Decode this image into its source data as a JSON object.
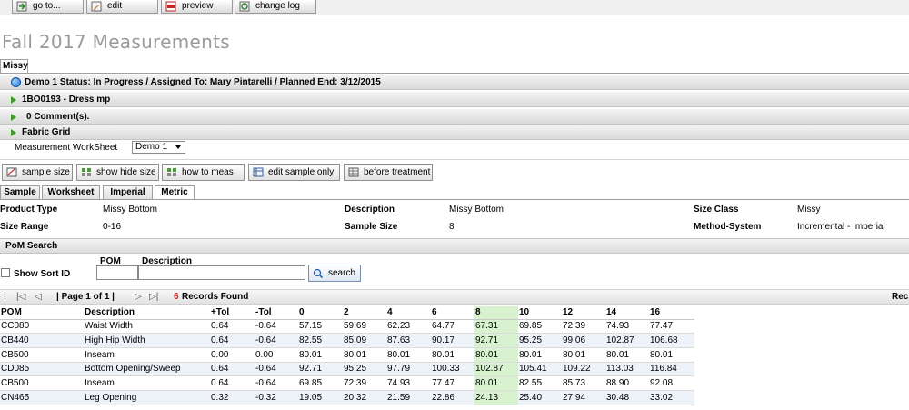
{
  "toolbar": {
    "goto": "go to...",
    "edit": "edit",
    "preview": "preview",
    "change_log": "change log"
  },
  "page_title": "Fall 2017 Measurements",
  "tab": "Missy",
  "sections": {
    "demo": "Demo 1  Status: In Progress / Assigned To: Mary Pintarelli / Planned End: 3/12/2015",
    "style": "1BO0193 - Dress mp",
    "comments": "0 Comment(s).",
    "fabric": "Fabric Grid"
  },
  "worksheet": {
    "label": "Measurement WorkSheet",
    "selected": "Demo 1"
  },
  "actions": {
    "sample_size": "sample size",
    "show_hide_size": "show hide size",
    "how_to_meas": "how to meas",
    "edit_sample_only": "edit sample only",
    "before_treatment": "before treatment"
  },
  "subtabs": [
    "Sample",
    "Worksheet",
    "Imperial",
    "Metric"
  ],
  "info": {
    "product_type_label": "Product Type",
    "product_type": "Missy Bottom",
    "description_label": "Description",
    "description": "Missy Bottom",
    "size_class_label": "Size Class",
    "size_class": "Missy",
    "size_range_label": "Size Range",
    "size_range": "0-16",
    "sample_size_label": "Sample Size",
    "sample_size": "8",
    "method_label": "Method-System",
    "method": "Incremental - Imperial"
  },
  "pom_search": {
    "title": "PoM Search",
    "show_sort": "Show Sort ID",
    "pom_label": "POM",
    "desc_label": "Description",
    "search_btn": "search"
  },
  "pager": {
    "page": "| Page 1 of 1 |",
    "count": "6",
    "found": "Records Found",
    "right": "Rec"
  },
  "grid": {
    "headers": [
      "POM",
      "Description",
      "+Tol",
      "-Tol",
      "0",
      "2",
      "4",
      "6",
      "8",
      "10",
      "12",
      "14",
      "16"
    ],
    "rows": [
      [
        "CC080",
        "Waist Width",
        "0.64",
        "-0.64",
        "57.15",
        "59.69",
        "62.23",
        "64.77",
        "67.31",
        "69.85",
        "72.39",
        "74.93",
        "77.47"
      ],
      [
        "CB440",
        "High Hip Width",
        "0.64",
        "-0.64",
        "82.55",
        "85.09",
        "87.63",
        "90.17",
        "92.71",
        "95.25",
        "99.06",
        "102.87",
        "106.68"
      ],
      [
        "CB500",
        "Inseam",
        "0.00",
        "0.00",
        "80.01",
        "80.01",
        "80.01",
        "80.01",
        "80.01",
        "80.01",
        "80.01",
        "80.01",
        "80.01"
      ],
      [
        "CD085",
        "Bottom Opening/Sweep",
        "0.64",
        "-0.64",
        "92.71",
        "95.25",
        "97.79",
        "100.33",
        "102.87",
        "105.41",
        "109.22",
        "113.03",
        "116.84"
      ],
      [
        "CB500",
        "Inseam",
        "0.64",
        "-0.64",
        "69.85",
        "72.39",
        "74.93",
        "77.47",
        "80.01",
        "82.55",
        "85.73",
        "88.90",
        "92.08"
      ],
      [
        "CN465",
        "Leg Opening",
        "0.32",
        "-0.32",
        "19.05",
        "20.32",
        "21.59",
        "22.86",
        "24.13",
        "25.40",
        "27.94",
        "30.48",
        "33.02"
      ]
    ]
  }
}
